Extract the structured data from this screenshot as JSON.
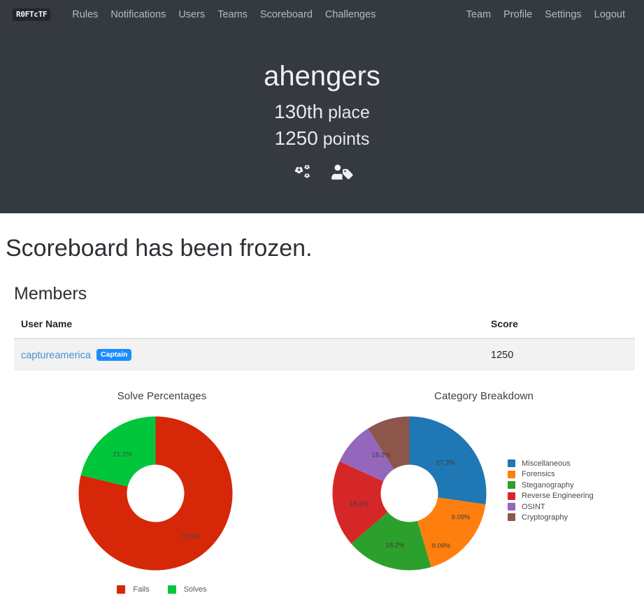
{
  "navbar": {
    "brand": "R0FTcTF",
    "brand_icon": "flag-logo-icon",
    "left_links": [
      {
        "label": "Rules",
        "name": "nav-link-rules"
      },
      {
        "label": "Notifications",
        "name": "nav-link-notifications"
      },
      {
        "label": "Users",
        "name": "nav-link-users"
      },
      {
        "label": "Teams",
        "name": "nav-link-teams"
      },
      {
        "label": "Scoreboard",
        "name": "nav-link-scoreboard"
      },
      {
        "label": "Challenges",
        "name": "nav-link-challenges"
      }
    ],
    "right_links": [
      {
        "label": "Team",
        "name": "nav-link-team"
      },
      {
        "label": "Profile",
        "name": "nav-link-profile"
      },
      {
        "label": "Settings",
        "name": "nav-link-settings"
      },
      {
        "label": "Logout",
        "name": "nav-link-logout"
      }
    ]
  },
  "hero": {
    "team_name": "ahengers",
    "place_value": "130th",
    "place_label": "place",
    "points_value": "1250",
    "points_label": "points",
    "icons": [
      {
        "name": "cogs-settings-icon"
      },
      {
        "name": "user-tag-icon"
      }
    ]
  },
  "main": {
    "frozen_notice": "Scoreboard has been frozen.",
    "members_heading": "Members"
  },
  "members_table": {
    "columns": [
      "User Name",
      "Score"
    ],
    "rows": [
      {
        "user": "captureamerica",
        "badge": "Captain",
        "score": "1250"
      }
    ]
  },
  "chart_data": [
    {
      "type": "pie",
      "title": "Solve Percentages",
      "categories": [
        "Fails",
        "Solves"
      ],
      "values": [
        78.8,
        21.2
      ],
      "labels": [
        "78.8%",
        "21.2%"
      ],
      "colors": [
        "#d62708",
        "#00c63c"
      ],
      "legend_position": "bottom",
      "donut": true
    },
    {
      "type": "pie",
      "title": "Category Breakdown",
      "categories": [
        "Miscellaneous",
        "Forensics",
        "Steganography",
        "Reverse Engineering",
        "OSINT",
        "Cryptography"
      ],
      "values": [
        27.3,
        18.2,
        18.2,
        18.2,
        9.09,
        9.09
      ],
      "labels": [
        "27.3%",
        "18.2%",
        "18.2%",
        "18.2%",
        "9.09%",
        "9.09%"
      ],
      "colors": [
        "#1f77b4",
        "#ff7f0e",
        "#2ca02c",
        "#d62728",
        "#9467bd",
        "#8c564b"
      ],
      "legend_position": "right",
      "donut": true
    }
  ],
  "colors": {
    "navbar_bg": "#343a40",
    "brand_accent": "#1a8cff",
    "link": "#4c8fcf",
    "row_bg": "#f2f2f2"
  }
}
